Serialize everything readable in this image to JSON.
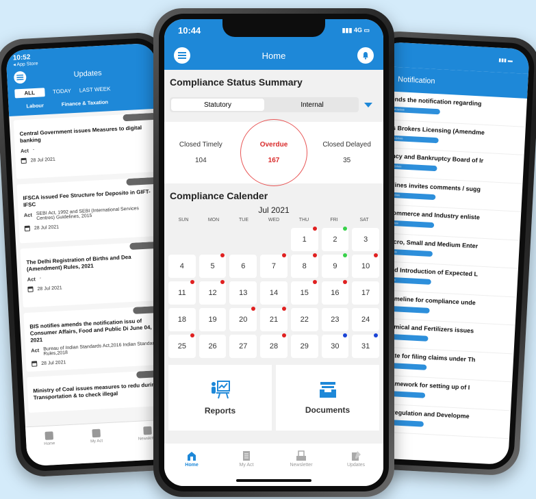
{
  "colors": {
    "brand": "#1e88d8",
    "overdue": "#d92b2b",
    "dot_red": "#e02020",
    "dot_green": "#38d14a",
    "dot_blue": "#1a44d6"
  },
  "left_phone": {
    "time": "10:52",
    "back_label": "◂ App Store",
    "title": "Updates",
    "tabs": [
      "ALL",
      "TODAY",
      "LAST WEEK"
    ],
    "subtabs": [
      "Labour",
      "Finance & Taxation"
    ],
    "updates": [
      {
        "title": "Central Government issues Measures to digital banking",
        "act_label": "Act",
        "act": "-",
        "date": "28 Jul 2021"
      },
      {
        "title": "IFSCA issued Fee Structure for Deposito in GIFT-IFSC",
        "act_label": "Act",
        "act": "SEBI Act, 1992 and SEBI (International Services Centres) Guidelines, 2015",
        "date": "28 Jul 2021"
      },
      {
        "title": "The Delhi Registration of Births and Dea (Amendment) Rules, 2021",
        "act_label": "Act",
        "act": "-",
        "date": "28 Jul 2021"
      },
      {
        "title": "BIS notifies amends the notification issu of Consumer Affairs, Food and Public Di June 04, 2021",
        "act_label": "Act",
        "act": "Bureau of Indian Standards Act,2016 Indian Standards Rules,2018",
        "date": "28 Jul 2021"
      },
      {
        "title": "Ministry of Coal issues measures to redu during Transportation & to check illegal",
        "act_label": "",
        "act": "",
        "date": ""
      }
    ],
    "nav": [
      "Home",
      "My Act",
      "Newsletter"
    ]
  },
  "right_phone": {
    "title": "Notification",
    "tag": "ComplianceUpdate",
    "items": [
      "I amends the notification regarding",
      "stoms Brokers Licensing (Amendme",
      "solvency and Bankruptcy Board of Ir",
      "ry of Mines invites comments / sugg",
      "ry of Commerce and Industry enliste",
      "ry of Micro, Small and Medium Enter",
      "as issued Introduction of Expected L",
      "sion of timeline for compliance unde",
      "ry of Chemical and Fertilizers issues",
      "sion of date for filing claims under Th",
      "issues Framework for setting up of I",
      "Dilfields (Regulation and Developme"
    ]
  },
  "center_phone": {
    "time": "10:44",
    "signal": "4G",
    "title": "Home",
    "summary_title": "Compliance Status Summary",
    "toggle": [
      "Statutory",
      "Internal"
    ],
    "stats": [
      {
        "label": "Closed Timely",
        "value": "104"
      },
      {
        "label": "Overdue",
        "value": "167"
      },
      {
        "label": "Closed Delayed",
        "value": "35"
      }
    ],
    "calendar_title": "Compliance Calender",
    "month": "Jul 2021",
    "weekdays": [
      "SUN",
      "MON",
      "TUE",
      "WED",
      "THU",
      "FRI",
      "SAT"
    ],
    "days": [
      {
        "d": "",
        "dot": ""
      },
      {
        "d": "",
        "dot": ""
      },
      {
        "d": "",
        "dot": ""
      },
      {
        "d": "",
        "dot": ""
      },
      {
        "d": "1",
        "dot": "red"
      },
      {
        "d": "2",
        "dot": "green"
      },
      {
        "d": "3",
        "dot": ""
      },
      {
        "d": "4",
        "dot": ""
      },
      {
        "d": "5",
        "dot": "red"
      },
      {
        "d": "6",
        "dot": ""
      },
      {
        "d": "7",
        "dot": "red"
      },
      {
        "d": "8",
        "dot": "red"
      },
      {
        "d": "9",
        "dot": "green"
      },
      {
        "d": "10",
        "dot": "red"
      },
      {
        "d": "11",
        "dot": "red"
      },
      {
        "d": "12",
        "dot": "red"
      },
      {
        "d": "13",
        "dot": ""
      },
      {
        "d": "14",
        "dot": ""
      },
      {
        "d": "15",
        "dot": "red"
      },
      {
        "d": "16",
        "dot": "red"
      },
      {
        "d": "17",
        "dot": ""
      },
      {
        "d": "18",
        "dot": ""
      },
      {
        "d": "19",
        "dot": ""
      },
      {
        "d": "20",
        "dot": "red"
      },
      {
        "d": "21",
        "dot": "red"
      },
      {
        "d": "22",
        "dot": ""
      },
      {
        "d": "23",
        "dot": ""
      },
      {
        "d": "24",
        "dot": ""
      },
      {
        "d": "25",
        "dot": "red"
      },
      {
        "d": "26",
        "dot": ""
      },
      {
        "d": "27",
        "dot": ""
      },
      {
        "d": "28",
        "dot": "red"
      },
      {
        "d": "29",
        "dot": ""
      },
      {
        "d": "30",
        "dot": "blue"
      },
      {
        "d": "31",
        "dot": "blue"
      }
    ],
    "tiles": [
      {
        "label": "Reports",
        "icon": "presentation-icon"
      },
      {
        "label": "Documents",
        "icon": "archive-tray-icon"
      }
    ],
    "nav": [
      "Home",
      "My Act",
      "Newsletter",
      "Updates"
    ]
  }
}
